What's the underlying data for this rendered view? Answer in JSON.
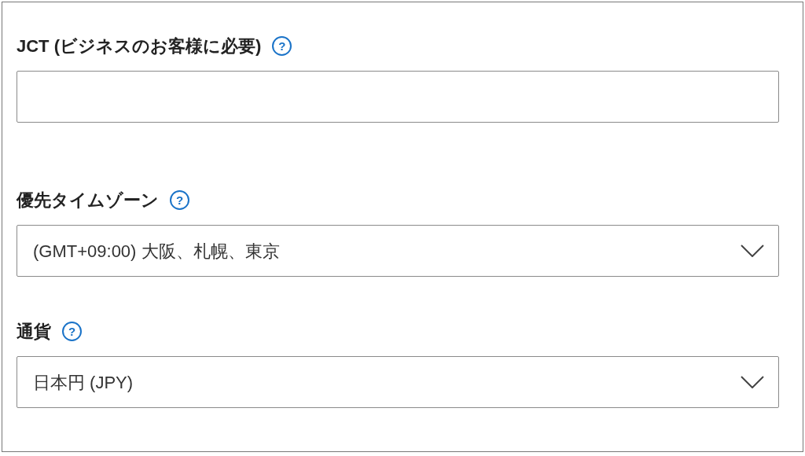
{
  "fields": [
    {
      "kind": "text",
      "label": "JCT (ビジネスのお客様に必要)",
      "help": "?"
    },
    {
      "kind": "select",
      "label": "優先タイムゾーン",
      "help": "?",
      "value": "(GMT+09:00) 大阪、札幌、東京"
    },
    {
      "kind": "select",
      "label": "通貨",
      "help": "?",
      "value": "日本円 (JPY)"
    }
  ]
}
